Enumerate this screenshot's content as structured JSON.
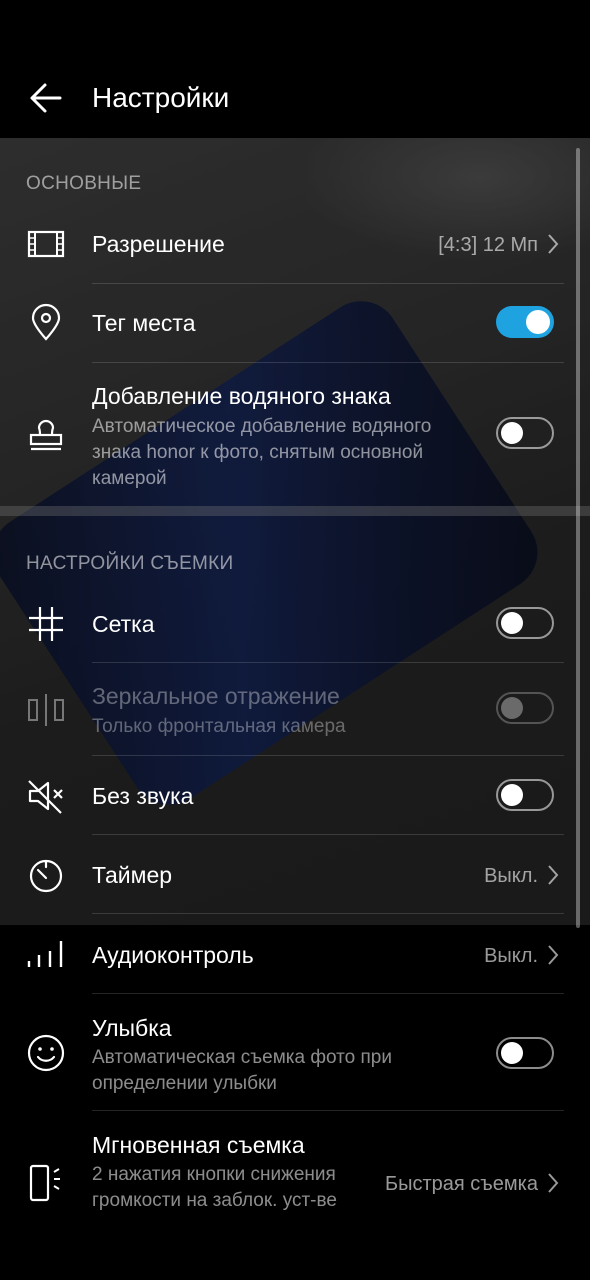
{
  "header": {
    "title": "Настройки",
    "back_icon": "arrow-left-icon"
  },
  "sections": {
    "basic": "ОСНОВНЫЕ",
    "shooting": "НАСТРОЙКИ СЪЕМКИ"
  },
  "items": {
    "resolution": {
      "label": "Разрешение",
      "value": "[4:3] 12 Мп",
      "icon": "film-frame-icon"
    },
    "location_tag": {
      "label": "Тег места",
      "enabled": true,
      "icon": "location-pin-icon"
    },
    "watermark": {
      "label": "Добавление водяного знака",
      "sub": "Автоматическое добавление водяного знака honor к фото, снятым основной камерой",
      "enabled": false,
      "icon": "stamp-icon"
    },
    "grid": {
      "label": "Сетка",
      "enabled": false,
      "icon": "grid-icon"
    },
    "mirror": {
      "label": "Зеркальное отражение",
      "sub": "Только фронтальная камера",
      "enabled": false,
      "disabled": true,
      "icon": "mirror-icon"
    },
    "mute": {
      "label": "Без звука",
      "enabled": false,
      "icon": "speaker-muted-icon"
    },
    "timer": {
      "label": "Таймер",
      "value": "Выкл.",
      "icon": "timer-icon"
    },
    "audio_control": {
      "label": "Аудиоконтроль",
      "value": "Выкл.",
      "icon": "audio-bars-icon"
    },
    "smile": {
      "label": "Улыбка",
      "sub": "Автоматическая съемка фото при определении улыбки",
      "enabled": false,
      "icon": "smile-icon"
    },
    "ultra_snapshot": {
      "label": "Мгновенная съемка",
      "sub": "2 нажатия кнопки снижения громкости на заблок. уст-ве",
      "value": "Быстрая съемка",
      "icon": "phone-volume-icon"
    }
  },
  "colors": {
    "accent": "#1fa3e0",
    "background": "#000000"
  }
}
